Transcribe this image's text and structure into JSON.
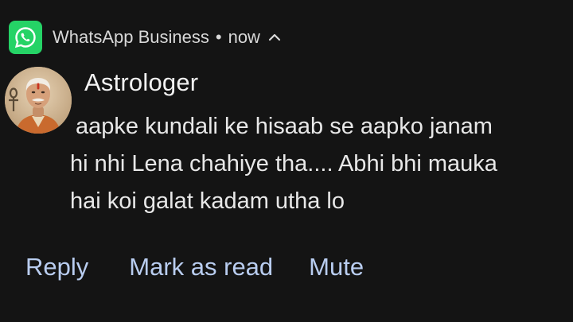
{
  "header": {
    "app_name": "WhatsApp Business",
    "separator": "•",
    "time": "now",
    "app_icon": "whatsapp-icon",
    "expand_icon": "chevron-up-icon"
  },
  "notification": {
    "sender": "Astrologer",
    "message_lines": [
      "aapke kundali ke hisaab se aapko janam",
      "hi nhi Lena chahiye tha.... Abhi bhi mauka",
      "hai koi galat kadam utha lo"
    ]
  },
  "actions": {
    "reply": "Reply",
    "mark_as_read": "Mark as read",
    "mute": "Mute"
  },
  "colors": {
    "background": "#141414",
    "action_text": "#b9cdf0",
    "whatsapp_green": "#25d366"
  }
}
